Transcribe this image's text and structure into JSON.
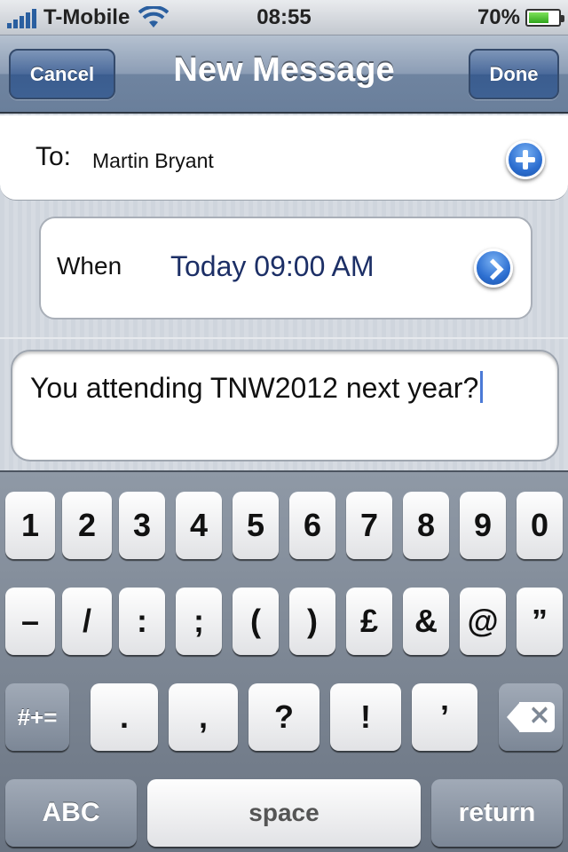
{
  "status_bar": {
    "carrier": "T-Mobile",
    "time": "08:55",
    "battery_percent": "70%",
    "battery_level": 0.7,
    "wifi_icon": "wifi-icon",
    "signal_icon": "signal-bars-icon"
  },
  "nav": {
    "cancel_label": "Cancel",
    "title": "New Message",
    "done_label": "Done"
  },
  "to": {
    "label": "To:",
    "value": "Martin Bryant",
    "add_icon": "plus-circle-icon"
  },
  "when": {
    "label": "When",
    "value": "Today 09:00 AM",
    "disclosure_icon": "chevron-right-icon"
  },
  "message": {
    "text": "You attending TNW2012 next year?"
  },
  "keyboard": {
    "row1": [
      "1",
      "2",
      "3",
      "4",
      "5",
      "6",
      "7",
      "8",
      "9",
      "0"
    ],
    "row2": [
      "–",
      "/",
      ":",
      ";",
      "(",
      ")",
      "£",
      "&",
      "@",
      "”"
    ],
    "row3": {
      "more_label": "#+=",
      "keys": [
        ".",
        ",",
        "?",
        "!",
        "’"
      ]
    },
    "row4": {
      "abc_label": "ABC",
      "space_label": "space",
      "return_label": "return"
    }
  },
  "colors": {
    "nav_button": "#3e6193",
    "when_value": "#1c2f66",
    "accent_blue": "#2d6fd1"
  }
}
